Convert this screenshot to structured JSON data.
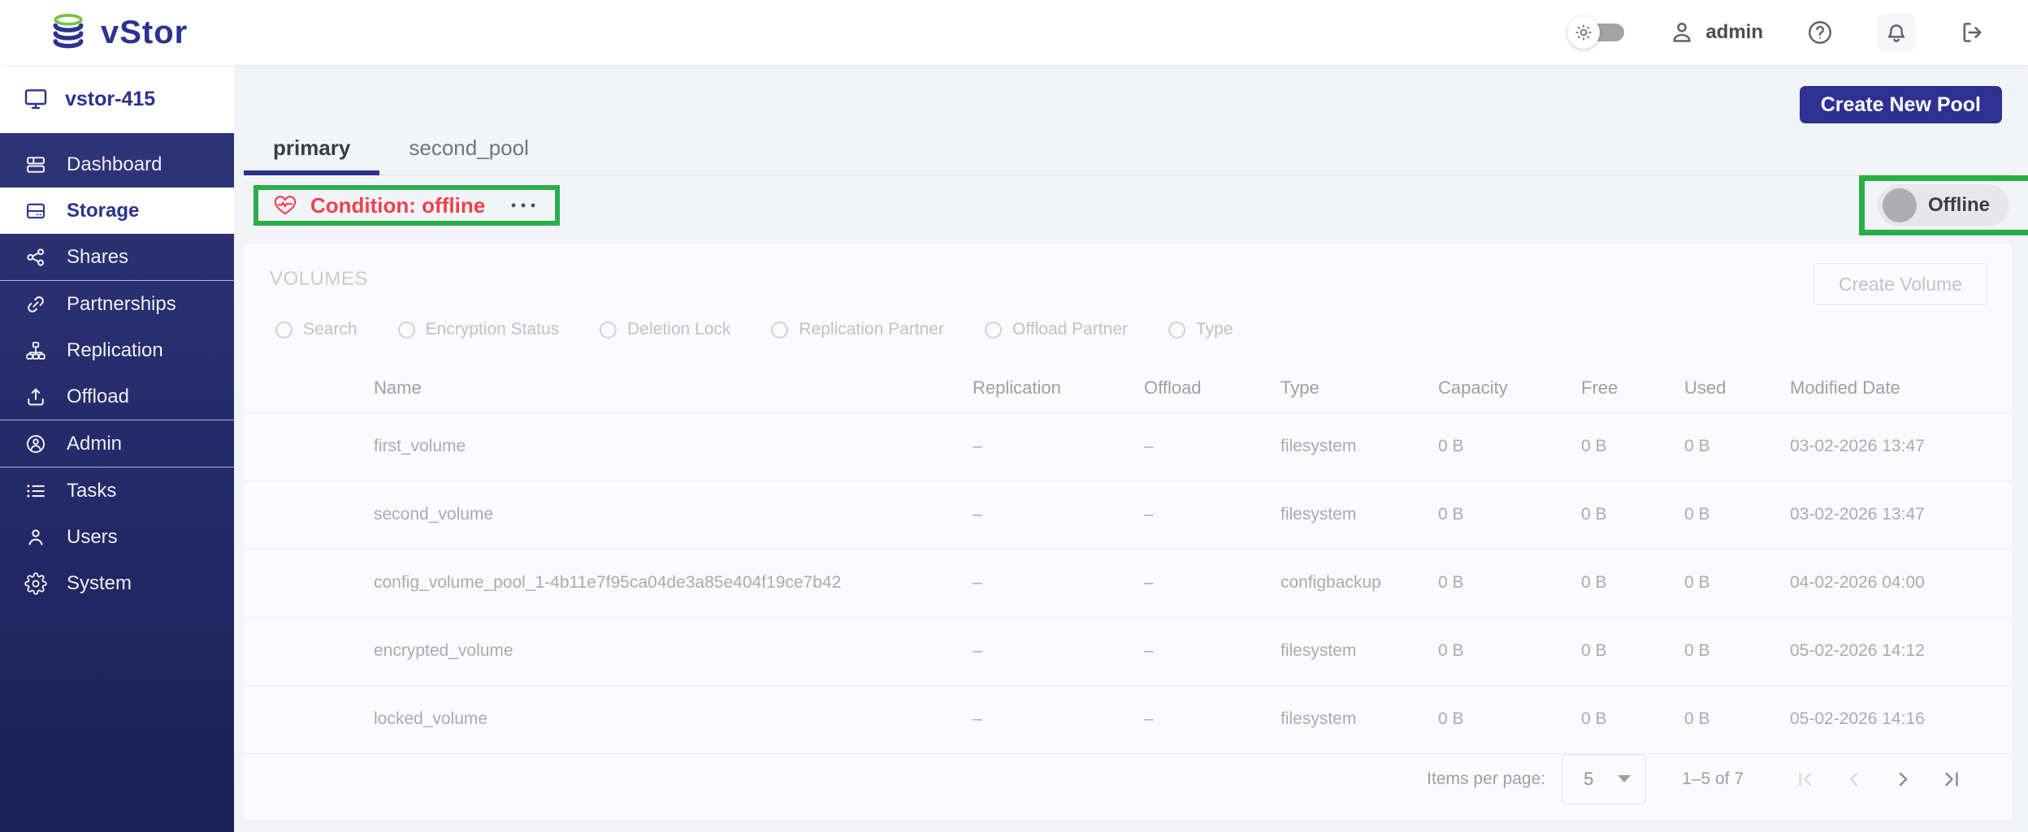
{
  "header": {
    "brand": "vStor",
    "user": "admin",
    "icons": [
      "theme-toggle",
      "user",
      "help",
      "notifications",
      "logout"
    ]
  },
  "sidebar": {
    "host": "vstor-415",
    "items": [
      {
        "label": "Dashboard",
        "active": false
      },
      {
        "label": "Storage",
        "active": true
      },
      {
        "label": "Shares",
        "active": false
      },
      {
        "label": "Partnerships",
        "active": false
      },
      {
        "label": "Replication",
        "active": false
      },
      {
        "label": "Offload",
        "active": false
      },
      {
        "label": "Admin",
        "active": false
      },
      {
        "label": "Tasks",
        "active": false
      },
      {
        "label": "Users",
        "active": false
      },
      {
        "label": "System",
        "active": false
      }
    ]
  },
  "pools": {
    "create_pool_label": "Create New Pool",
    "tabs": [
      {
        "label": "primary",
        "active": true
      },
      {
        "label": "second_pool",
        "active": false
      }
    ],
    "condition_label": "Condition: offline",
    "condition_status": "offline",
    "toggle_label": "Offline",
    "toggle_state": "off"
  },
  "volumes": {
    "title": "VOLUMES",
    "create_volume_label": "Create Volume",
    "create_volume_enabled": false,
    "filters": [
      "Search",
      "Encryption Status",
      "Deletion Lock",
      "Replication Partner",
      "Offload Partner",
      "Type"
    ],
    "columns": [
      "Name",
      "Replication",
      "Offload",
      "Type",
      "Capacity",
      "Free",
      "Used",
      "Modified Date"
    ],
    "rows": [
      {
        "name": "first_volume",
        "replication": "–",
        "offload": "–",
        "type": "filesystem",
        "capacity": "0 B",
        "free": "0 B",
        "used": "0 B",
        "modified": "03-02-2026 13:47"
      },
      {
        "name": "second_volume",
        "replication": "–",
        "offload": "–",
        "type": "filesystem",
        "capacity": "0 B",
        "free": "0 B",
        "used": "0 B",
        "modified": "03-02-2026 13:47"
      },
      {
        "name": "config_volume_pool_1-4b11e7f95ca04de3a85e404f19ce7b42",
        "replication": "–",
        "offload": "–",
        "type": "configbackup",
        "capacity": "0 B",
        "free": "0 B",
        "used": "0 B",
        "modified": "04-02-2026 04:00"
      },
      {
        "name": "encrypted_volume",
        "replication": "–",
        "offload": "–",
        "type": "filesystem",
        "capacity": "0 B",
        "free": "0 B",
        "used": "0 B",
        "modified": "05-02-2026 14:12"
      },
      {
        "name": "locked_volume",
        "replication": "–",
        "offload": "–",
        "type": "filesystem",
        "capacity": "0 B",
        "free": "0 B",
        "used": "0 B",
        "modified": "05-02-2026 14:16"
      }
    ],
    "pagination": {
      "items_per_page_label": "Items per page:",
      "page_size": "5",
      "range": "1–5 of 7"
    }
  },
  "colors": {
    "navy": "#2d3190",
    "sidebar_gradient_top": "#31367b",
    "sidebar_gradient_bottom": "#1c2057",
    "error_red": "#ef4050",
    "annotation_green": "#2aae4a",
    "page_bg": "#f3f4f7",
    "card_bg": "#fbfbfd",
    "logo_green": "#7ac143"
  }
}
